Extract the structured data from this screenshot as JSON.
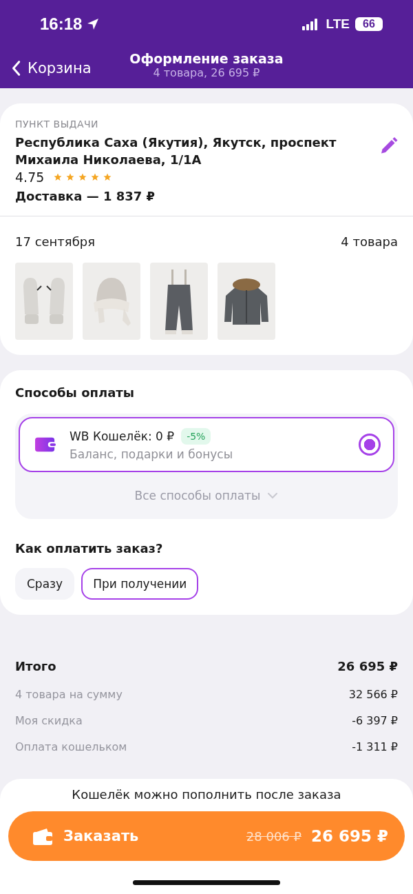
{
  "status_bar": {
    "time": "16:18",
    "network": "LTE",
    "battery": "66"
  },
  "nav": {
    "back_label": "Корзина",
    "title": "Оформление заказа",
    "subtitle": "4 товара, 26 695 ₽"
  },
  "pickup": {
    "label": "ПУНКТ ВЫДАЧИ",
    "address": "Республика Саха (Якутия), Якутск, проспект Михаила Николаева, 1/1А",
    "rating": "4.75",
    "stars": 5,
    "delivery": "Доставка — 1 837 ₽"
  },
  "shipment": {
    "date": "17 сентября",
    "count": "4 товара"
  },
  "payment": {
    "title": "Способы оплаты",
    "methods": [
      {
        "name": "WB Кошелёк: 0 ₽",
        "badge": "-5%",
        "description": "Баланс, подарки и бонусы",
        "selected": true
      }
    ],
    "all_methods": "Все способы оплаты",
    "timing_title": "Как оплатить заказ?",
    "timing_options": [
      {
        "label": "Сразу",
        "selected": false
      },
      {
        "label": "При получении",
        "selected": true
      }
    ]
  },
  "summary": {
    "title": "Итого",
    "total": "26 695 ₽",
    "rows": [
      {
        "label": "4 товара на сумму",
        "value": "32 566 ₽"
      },
      {
        "label": "Моя скидка",
        "value": "-6 397 ₽"
      },
      {
        "label": "Оплата кошельком",
        "value": "-1 311 ₽"
      }
    ]
  },
  "footer": {
    "note": "Кошелёк можно пополнить после заказа",
    "button": {
      "label": "Заказать",
      "old_price": "28 006 ₽",
      "price": "26 695 ₽"
    }
  }
}
